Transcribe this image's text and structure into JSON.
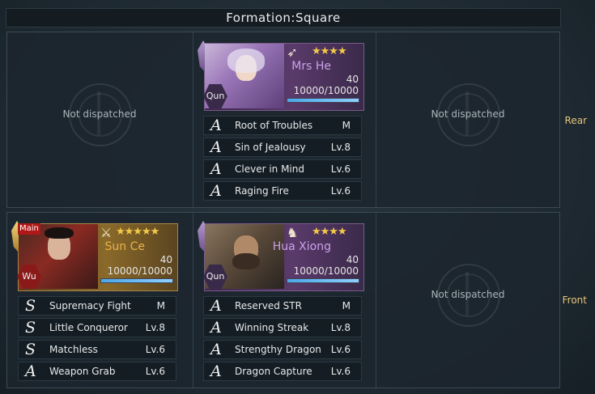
{
  "title": "Formation:Square",
  "rows": {
    "rear": "Rear",
    "front": "Front"
  },
  "empty_text": "Not dispatched",
  "rear": {
    "left": {
      "text": "Not dispatched"
    },
    "center": {
      "name": "Mrs He",
      "stars": "★★★★",
      "level": "40",
      "troops": "10000/10000",
      "troops_ratio": 1.0,
      "faction": "Qun",
      "weapon_icon": "bow-icon",
      "skills": [
        {
          "grade": "A",
          "name": "Root of Troubles",
          "level": "M"
        },
        {
          "grade": "A",
          "name": "Sin of Jealousy",
          "level": "Lv.8"
        },
        {
          "grade": "A",
          "name": "Clever in Mind",
          "level": "Lv.6"
        },
        {
          "grade": "A",
          "name": "Raging Fire",
          "level": "Lv.6"
        }
      ]
    },
    "right": {
      "text": "Not dispatched"
    }
  },
  "front": {
    "left": {
      "name": "Sun Ce",
      "stars": "★★★★★",
      "level": "40",
      "troops": "10000/10000",
      "troops_ratio": 1.0,
      "faction": "Wu",
      "weapon_icon": "spear-icon",
      "tag": "Main",
      "skills": [
        {
          "grade": "S",
          "name": "Supremacy Fight",
          "level": "M"
        },
        {
          "grade": "S",
          "name": "Little Conqueror",
          "level": "Lv.8"
        },
        {
          "grade": "S",
          "name": "Matchless",
          "level": "Lv.6"
        },
        {
          "grade": "A",
          "name": "Weapon Grab",
          "level": "Lv.6"
        }
      ]
    },
    "center": {
      "name": "Hua Xiong",
      "stars": "★★★★",
      "level": "40",
      "troops": "10000/10000",
      "troops_ratio": 1.0,
      "faction": "Qun",
      "weapon_icon": "cavalry-icon",
      "skills": [
        {
          "grade": "A",
          "name": "Reserved STR",
          "level": "M"
        },
        {
          "grade": "A",
          "name": "Winning Streak",
          "level": "Lv.8"
        },
        {
          "grade": "A",
          "name": "Strengthy Dragon",
          "level": "Lv.6"
        },
        {
          "grade": "A",
          "name": "Dragon Capture",
          "level": "Lv.6"
        }
      ]
    },
    "right": {
      "text": "Not dispatched"
    }
  }
}
